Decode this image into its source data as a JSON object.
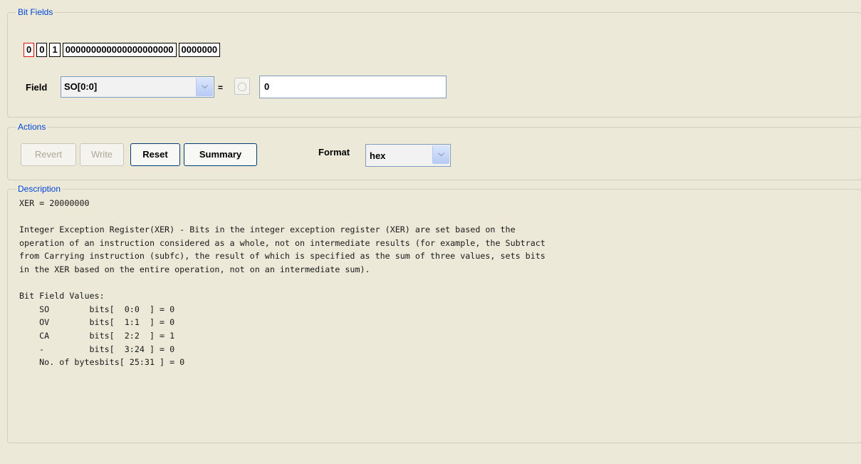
{
  "bit_fields": {
    "legend": "Bit Fields",
    "bits": [
      "0",
      "0",
      "1",
      "000000000000000000000",
      "0000000"
    ],
    "field_label": "Field",
    "field_value": "SO[0:0]",
    "equals": "=",
    "value": "0"
  },
  "actions": {
    "legend": "Actions",
    "revert": "Revert",
    "write": "Write",
    "reset": "Reset",
    "summary": "Summary",
    "format_label": "Format",
    "format_value": "hex"
  },
  "description": {
    "legend": "Description",
    "text": "XER = 20000000\n\nInteger Exception Register(XER) - Bits in the integer exception register (XER) are set based on the\noperation of an instruction considered as a whole, not on intermediate results (for example, the Subtract\nfrom Carrying instruction (subfc), the result of which is specified as the sum of three values, sets bits\nin the XER based on the entire operation, not on an intermediate sum).\n\nBit Field Values:\n    SO        bits[  0:0  ] = 0\n    OV        bits[  1:1  ] = 0\n    CA        bits[  2:2  ] = 1\n    -         bits[  3:24 ] = 0\n    No. of bytesbits[ 25:31 ] = 0"
  },
  "colors": {
    "background": "#ece9d8",
    "legend": "#0046d5",
    "selected_bit_border": "#e01010"
  }
}
